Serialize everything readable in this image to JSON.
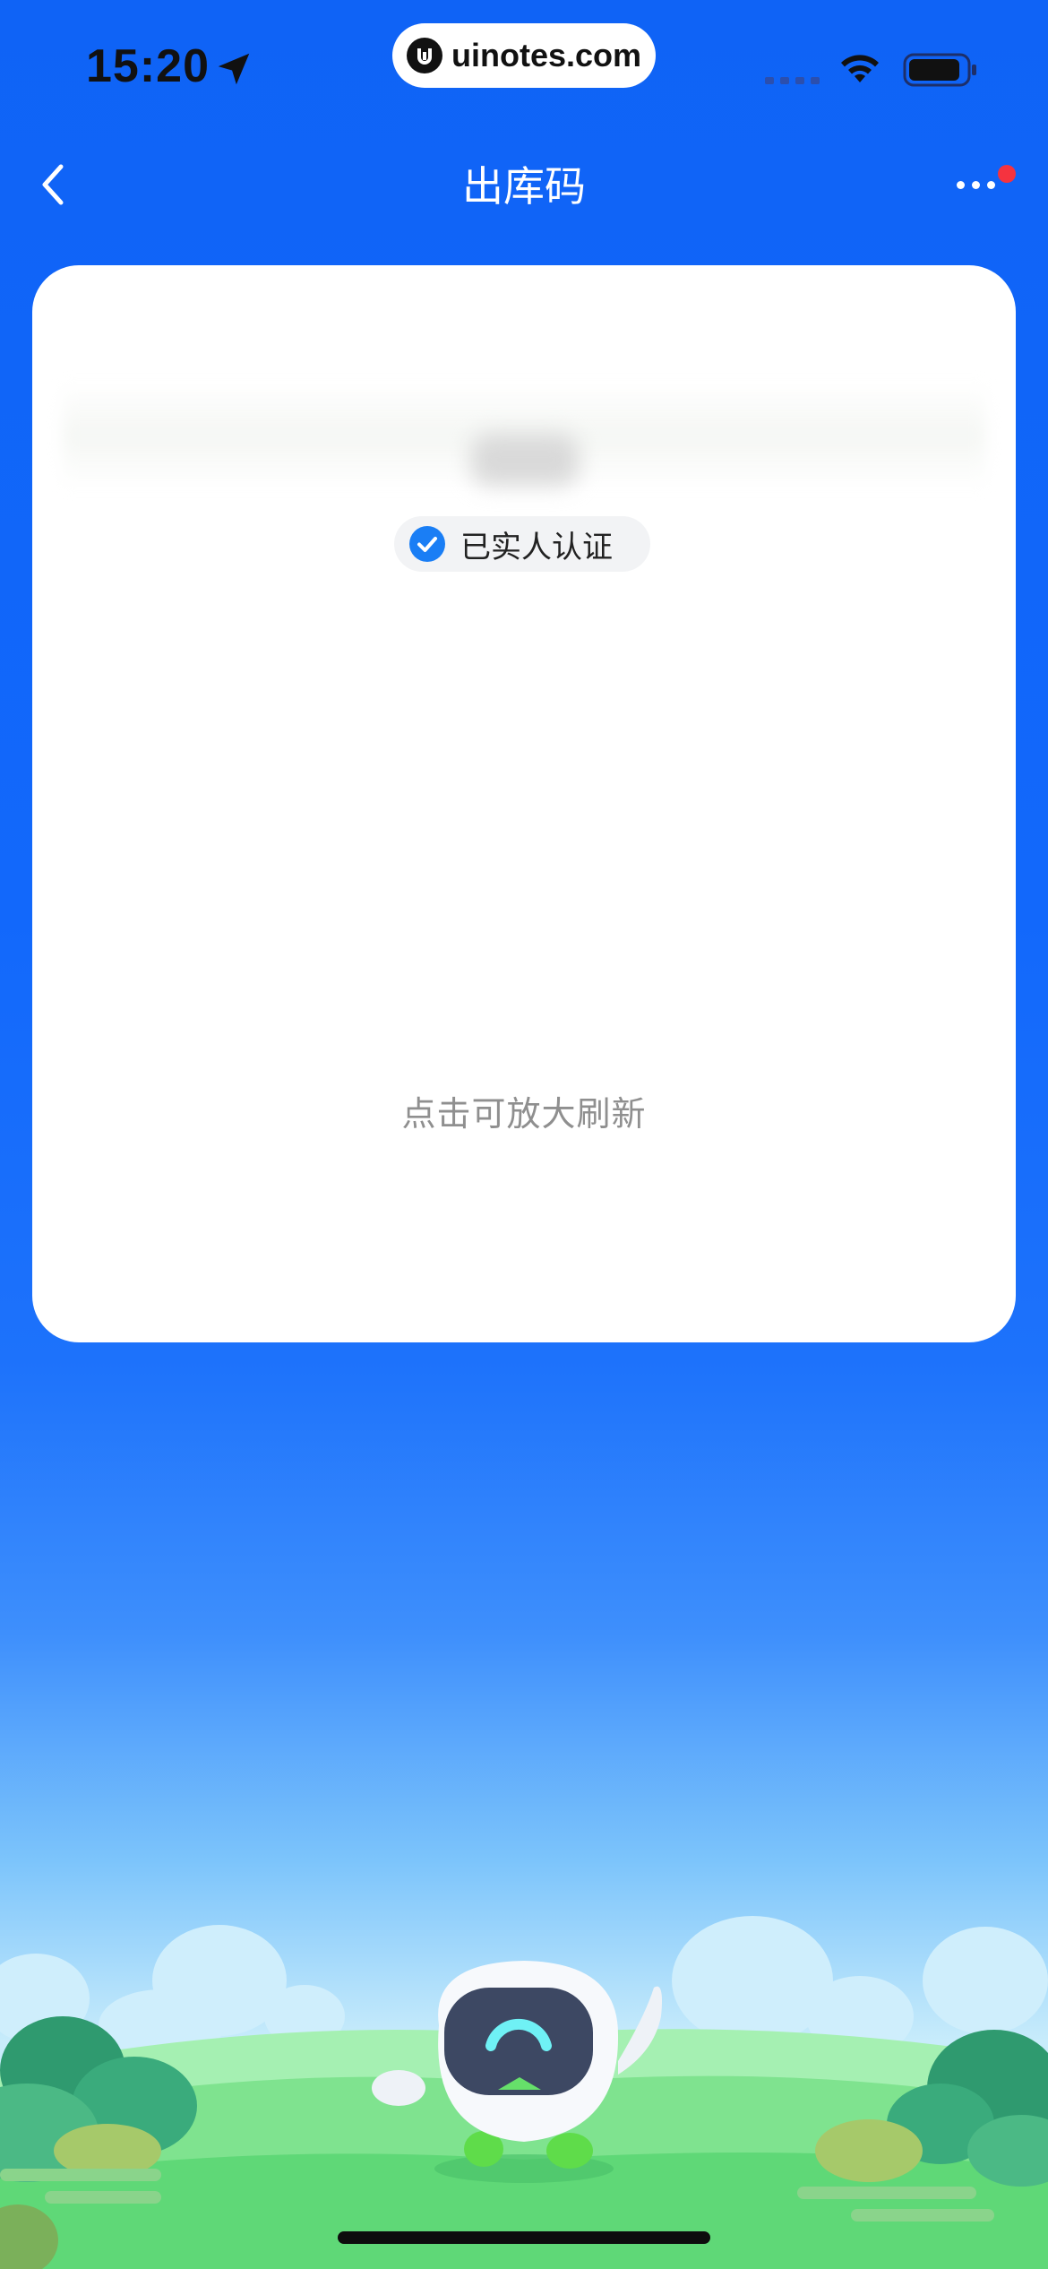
{
  "status_bar": {
    "time": "15:20",
    "brand": "uinotes.com",
    "icons": [
      "location-arrow-icon",
      "signal-icon",
      "wifi-icon",
      "battery-icon"
    ]
  },
  "nav": {
    "title": "出库码",
    "back_icon": "chevron-left-icon",
    "more_icon": "more-dots-icon",
    "has_notification": true
  },
  "card": {
    "verified_label": "已实人认证",
    "refresh_tip": "点击可放大刷新"
  },
  "colors": {
    "primary_blue": "#1268fb",
    "verified_blue": "#1a7ef5",
    "notification_red": "#f5333f",
    "tip_gray": "#8f8f8f"
  }
}
